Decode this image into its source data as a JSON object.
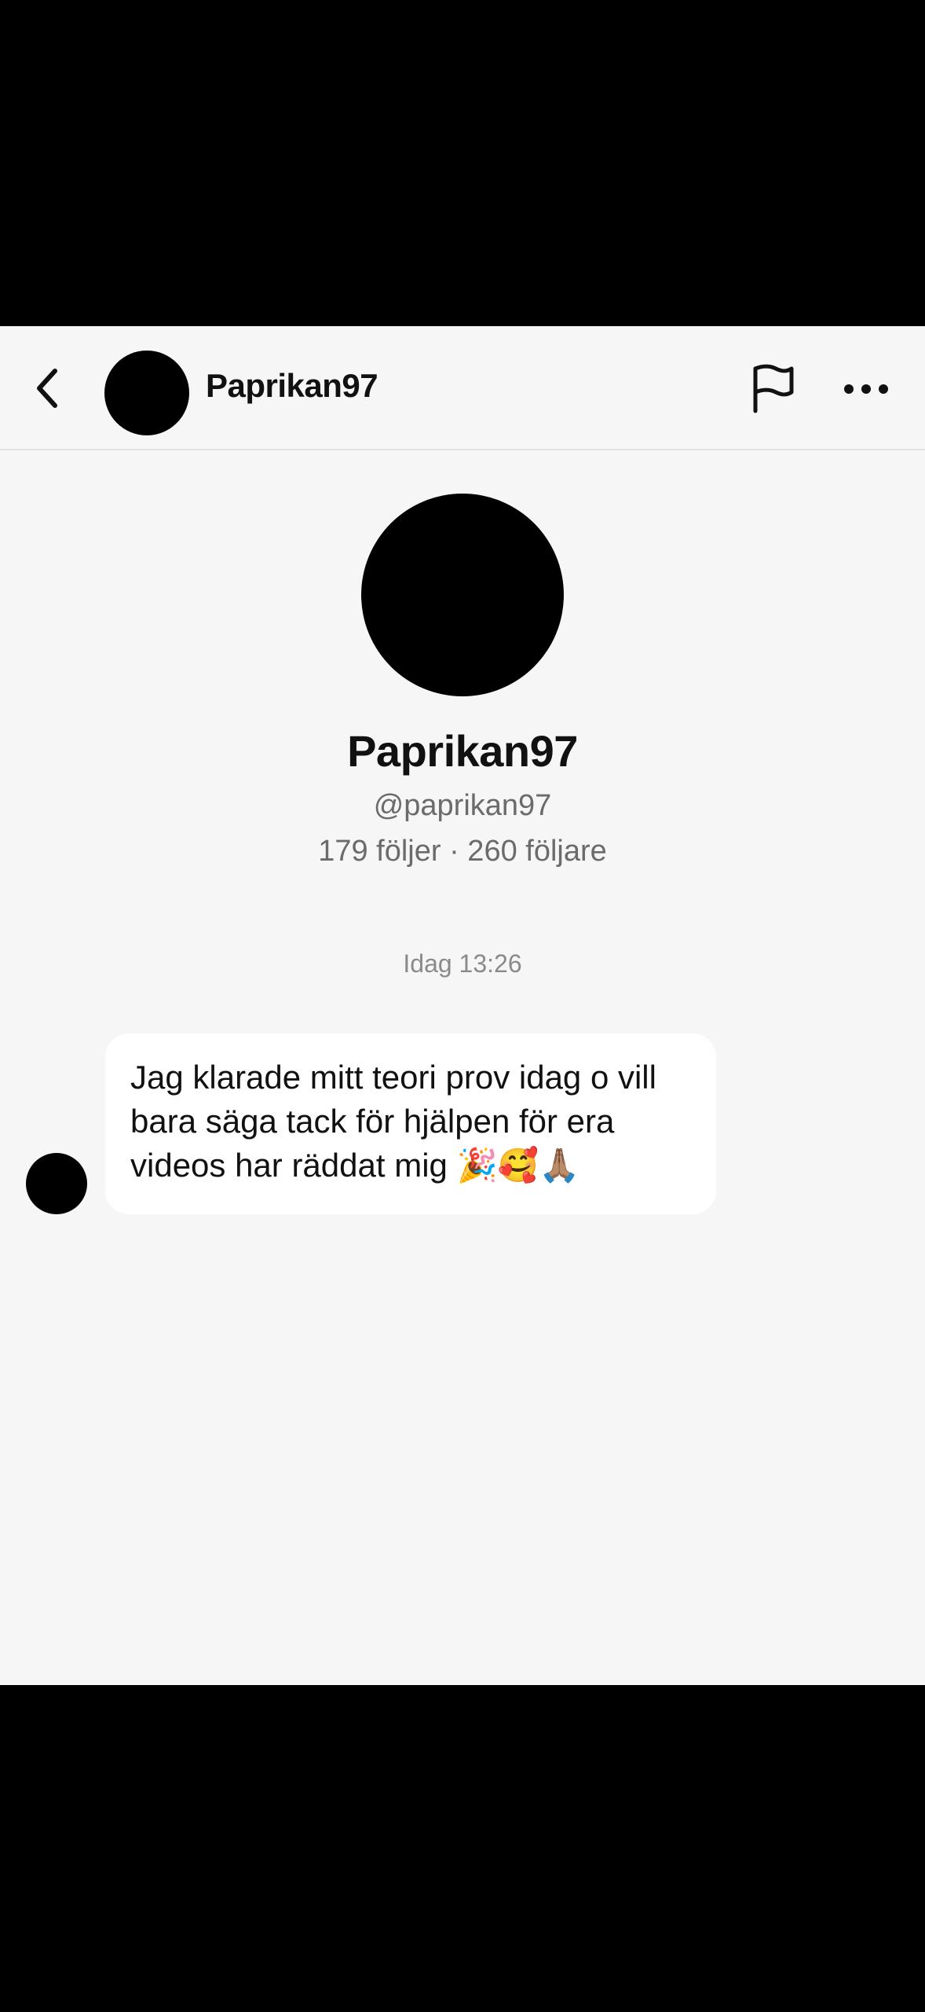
{
  "header": {
    "username": "Paprikan97"
  },
  "profile": {
    "display_name": "Paprikan97",
    "handle": "@paprikan97",
    "stats": "179 följer · 260 följare"
  },
  "chat": {
    "timestamp": "Idag 13:26",
    "messages": [
      {
        "text": "Jag klarade mitt teori prov idag o vill bara säga tack för hjälpen för era videos har räddat mig 🎉🥰🙏🏽"
      }
    ]
  },
  "icons": {
    "back": "chevron-left-icon",
    "report": "flag-icon",
    "more": "more-horizontal-icon"
  },
  "colors": {
    "background": "#f6f6f6",
    "bubble": "#ffffff",
    "text_primary": "#111111",
    "text_secondary": "#6b6b6b",
    "text_muted": "#8a8a8a"
  }
}
